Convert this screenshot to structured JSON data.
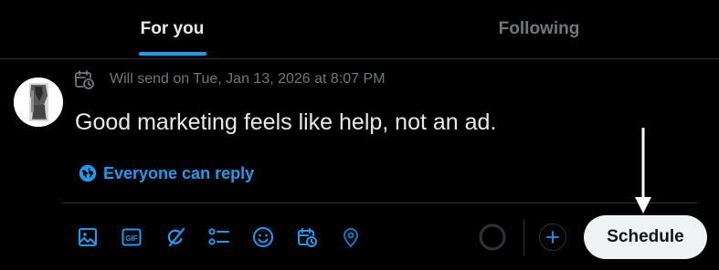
{
  "tabs": [
    {
      "label": "For you",
      "active": true
    },
    {
      "label": "Following",
      "active": false
    }
  ],
  "composer": {
    "schedule_notice": "Will send on Tue, Jan 13, 2026 at 8:07 PM",
    "text": "Good marketing feels like help, not an ad.",
    "reply_setting": "Everyone can reply"
  },
  "toolbar": {
    "icons": [
      "image-icon",
      "gif-icon",
      "grok-icon",
      "poll-icon",
      "emoji-icon",
      "schedule-icon",
      "location-icon"
    ],
    "gif_label": "GIF",
    "schedule_label": "Schedule"
  },
  "colors": {
    "accent": "#1d9bf0",
    "background": "#000000",
    "text_primary": "#e7e9ea",
    "text_secondary": "#71767b",
    "border": "#2f3336",
    "button_bg": "#eff3f4"
  }
}
